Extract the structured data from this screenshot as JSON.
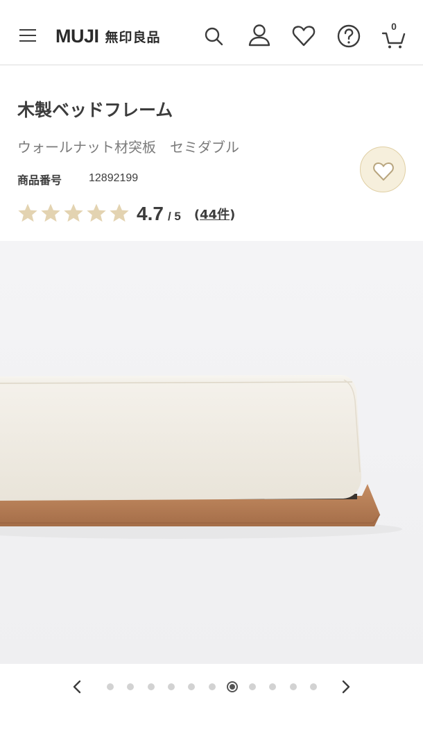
{
  "header": {
    "brand_latin": "MUJI",
    "brand_jp": "無印良品",
    "cart_count": "0",
    "icons": [
      "menu-icon",
      "search-icon",
      "user-icon",
      "heart-icon",
      "help-icon",
      "cart-icon"
    ]
  },
  "product": {
    "title": "木製ベッドフレーム",
    "subtitle": "ウォールナット材突板　セミダブル",
    "code_label": "商品番号",
    "code": "12892199",
    "rating_value": "4.7",
    "rating_max": "/ 5",
    "review_count_open": "(",
    "review_count": "44件",
    "review_count_close": ")",
    "stars_filled": 5
  },
  "gallery": {
    "total_images": 11,
    "current_index": 7
  },
  "colors": {
    "star": "#e3d3b1",
    "fav_bg": "#f6efdc",
    "wood": "#b87d55",
    "gallery_bg": "#f1f1f3"
  }
}
